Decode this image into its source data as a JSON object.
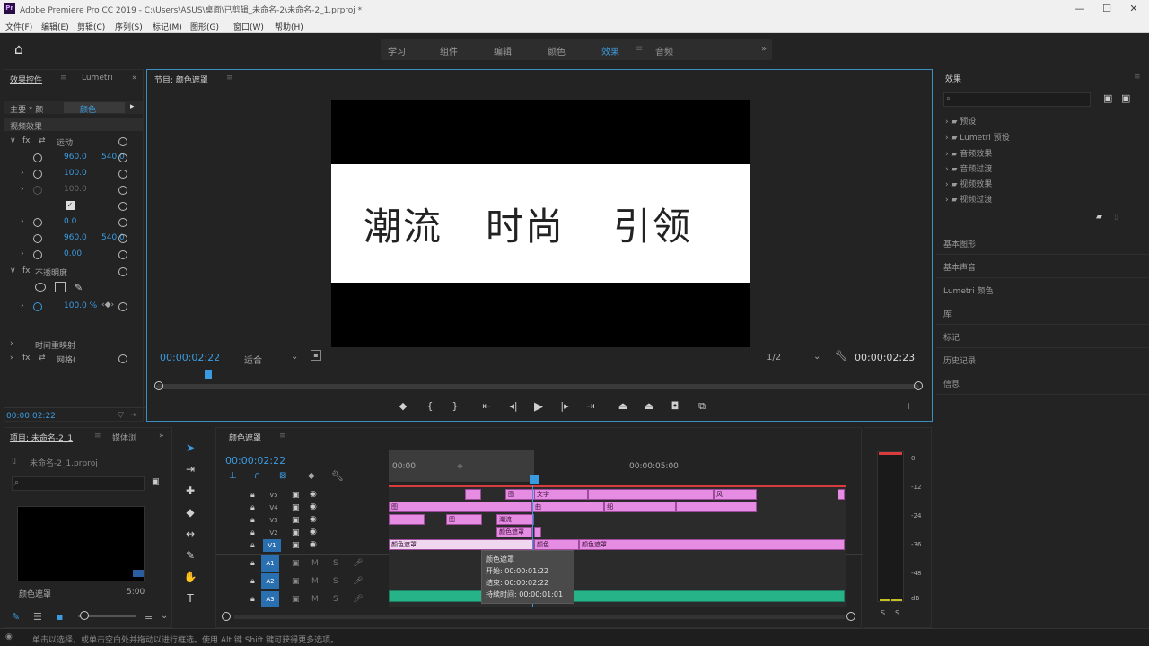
{
  "window": {
    "title": "Adobe Premiere Pro CC 2019 - C:\\Users\\ASUS\\桌面\\已剪辑_未命名-2\\未命名-2_1.prproj *",
    "logo_text": "Pr",
    "minimize": "—",
    "maximize": "☐",
    "close": "✕"
  },
  "menu": [
    "文件(F)",
    "编辑(E)",
    "剪辑(C)",
    "序列(S)",
    "标记(M)",
    "图形(G)",
    "窗口(W)",
    "帮助(H)"
  ],
  "workspaces": {
    "items": [
      "学习",
      "组件",
      "编辑",
      "颜色",
      "效果",
      "音频"
    ],
    "active": "效果",
    "more": "»"
  },
  "effect_controls": {
    "tabs": [
      "效果控件",
      "Lumetri"
    ],
    "active_tab": "效果控件",
    "source_label": "主要 * 颜",
    "sequence_label": "颜色",
    "section_video": "视频效果",
    "motion_label": "运动",
    "opacity_label": "不透明度",
    "time_remap_label": "时间重映射",
    "last_effect_label": "网格(",
    "values": [
      "960.0",
      "540.0",
      "100.0",
      "100.0",
      "0.0",
      "960.0",
      "540.0",
      "0.00",
      "100.0 %"
    ],
    "timecode": "00:00:02:22"
  },
  "program_monitor": {
    "tab": "节目: 颜色遮罩",
    "video_text": [
      "潮流",
      "时尚",
      "引领"
    ],
    "timecode_left": "00:00:02:22",
    "fit_label": "适合",
    "resolution": "1/2",
    "timecode_right": "00:00:02:23"
  },
  "effects_panel": {
    "tab": "效果",
    "folders": [
      "预设",
      "Lumetri 预设",
      "音频效果",
      "音频过渡",
      "视频效果",
      "视频过渡"
    ],
    "sections": [
      "基本图形",
      "基本声音",
      "Lumetri 颜色",
      "库",
      "标记",
      "历史记录",
      "信息"
    ]
  },
  "project_panel": {
    "tabs": [
      "项目: 未命名-2_1",
      "媒体浏"
    ],
    "active_tab": "项目: 未命名-2_1",
    "file_name": "未命名-2_1.prproj",
    "clip_name": "颜色遮罩",
    "clip_duration": "5:00"
  },
  "timeline": {
    "tab": "颜色遮罩",
    "timecode": "00:00:02:22",
    "ruler": [
      "00:00",
      "00:00:05:00"
    ],
    "video_tracks": [
      "V5",
      "V4",
      "V3",
      "V2",
      "V1"
    ],
    "audio_tracks": [
      "A1",
      "A2",
      "A3"
    ],
    "clips": {
      "v5": [
        "图",
        "文字",
        "风"
      ],
      "v4": [
        "图",
        "曲",
        "细"
      ],
      "v3": [
        "图",
        "潮流"
      ],
      "v2": [
        "颜色遮罩"
      ],
      "v1": [
        "颜色遮罩",
        "颜色",
        "颜色遮罩"
      ]
    },
    "tooltip": {
      "title": "颜色遮罩",
      "start_label": "开始:",
      "start": "00:00:01:22",
      "end_label": "结束:",
      "end": "00:00:02:22",
      "duration_label": "持续时间:",
      "duration": "00:00:01:01"
    }
  },
  "meter": {
    "labels": [
      "0",
      "-12",
      "-24",
      "-36",
      "-48",
      "dB"
    ]
  },
  "status": {
    "text": "单击以选择，或单击空白处并拖动以进行框选。使用 Alt 键 Shift 键可获得更多选项。"
  },
  "colors": {
    "accent": "#3b9be0",
    "clip_pink": "#e78ce3",
    "audio_green": "#27b388",
    "playhead": "#d93c3c"
  }
}
